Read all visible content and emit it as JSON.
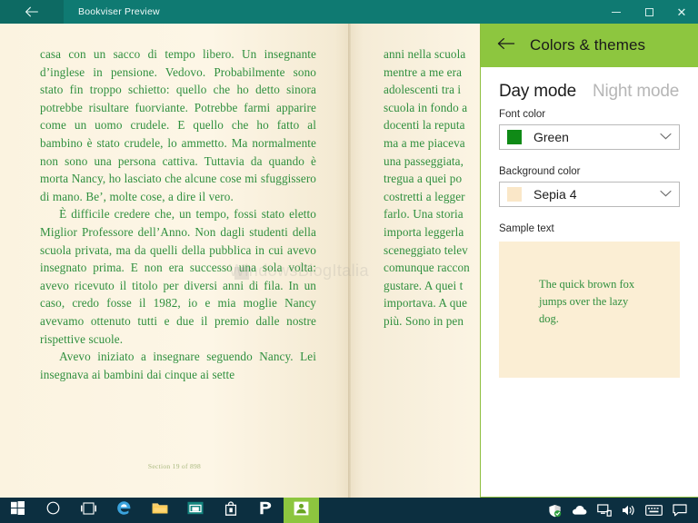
{
  "window": {
    "title": "Bookviser Preview",
    "back_icon": "back-arrow-icon",
    "minimize_label": "–",
    "maximize_label": "□",
    "close_label": "✕"
  },
  "reader": {
    "left_page": {
      "paragraphs": [
        "casa con un sacco di tempo libero. Un insegnante d’inglese in pensione. Vedovo. Probabilmente sono stato fin troppo schietto: quello che ho detto sinora potrebbe risultare fuorviante. Potrebbe farmi apparire come un uomo crudele. E quello che ho fatto al bambino è stato crudele, lo ammetto. Ma normalmente non sono una persona cattiva. Tuttavia da quando è morta Nancy, ho lasciato che alcune cose mi sfuggissero di mano. Be’, molte cose, a dire il vero.",
        "È difficile credere che, un tempo, fossi stato eletto Miglior Professore dell’Anno. Non dagli studenti della scuola privata, ma da quelli della pubblica in cui avevo insegnato prima. E non era successo una sola volta: avevo ricevuto il titolo per diversi anni di fila. In un caso, credo fosse il 1982, io e mia moglie Nancy avevamo ottenuto tutti e due il premio dalle nostre rispettive scuole.",
        "Avevo iniziato a insegnare seguendo Nancy. Lei insegnava ai bambini dai cinque ai sette"
      ],
      "footer": "Section 19 of 898"
    },
    "right_page": {
      "lines": [
        "anni nella scuola",
        "mentre a me era",
        "adolescenti tra i",
        "scuola in fondo a",
        "docenti la reputa",
        "ma a me piaceva",
        "una passeggiata,",
        "tregua a quei po",
        "costretti a legger",
        "farlo. Una storia",
        "importa leggerla",
        "sceneggiato telev",
        "comunque raccon",
        "gustare. A quei t",
        "importava. A que",
        "più. Sono in pen"
      ]
    },
    "watermark": "WindowsBlogItalia",
    "font_color_hex": "#2f8f3e",
    "page_bg_hex": "#fdf6e6"
  },
  "flyout": {
    "back_icon": "back-arrow-icon",
    "title": "Colors & themes",
    "header_color": "#8dc63f",
    "modes": [
      {
        "label": "Day mode",
        "active": true
      },
      {
        "label": "Night mode",
        "active": false
      }
    ],
    "font_color": {
      "label": "Font color",
      "value": "Green",
      "swatch_hex": "#0f8a16",
      "chevron_icon": "chevron-down-icon"
    },
    "background_color": {
      "label": "Background color",
      "value": "Sepia 4",
      "swatch_hex": "#fae7c8",
      "chevron_icon": "chevron-down-icon"
    },
    "sample": {
      "label": "Sample text",
      "text": "The quick brown fox jumps over the lazy dog.",
      "bg_hex": "#fbeed4",
      "fg_hex": "#2f8f3e"
    }
  },
  "taskbar": {
    "bg_hex": "#0c2f40",
    "items": [
      {
        "name": "start-button",
        "icon": "windows-logo-icon"
      },
      {
        "name": "cortana-button",
        "icon": "circle-icon"
      },
      {
        "name": "task-view-button",
        "icon": "task-view-icon"
      },
      {
        "name": "edge-button",
        "icon": "edge-icon"
      },
      {
        "name": "file-explorer-button",
        "icon": "folder-icon"
      },
      {
        "name": "photos-button",
        "icon": "photos-icon"
      },
      {
        "name": "store-button",
        "icon": "store-bag-icon"
      },
      {
        "name": "groove-button",
        "icon": "groove-music-icon"
      },
      {
        "name": "bookviser-button",
        "icon": "bookviser-icon"
      }
    ],
    "tray": [
      {
        "name": "security-tray-icon",
        "icon": "shield-check-icon"
      },
      {
        "name": "onedrive-tray-icon",
        "icon": "cloud-icon"
      },
      {
        "name": "network-tray-icon",
        "icon": "monitor-network-icon"
      },
      {
        "name": "volume-tray-icon",
        "icon": "speaker-icon"
      },
      {
        "name": "keyboard-tray-icon",
        "icon": "keyboard-icon"
      },
      {
        "name": "action-center-icon",
        "icon": "speech-bubble-icon"
      }
    ]
  }
}
